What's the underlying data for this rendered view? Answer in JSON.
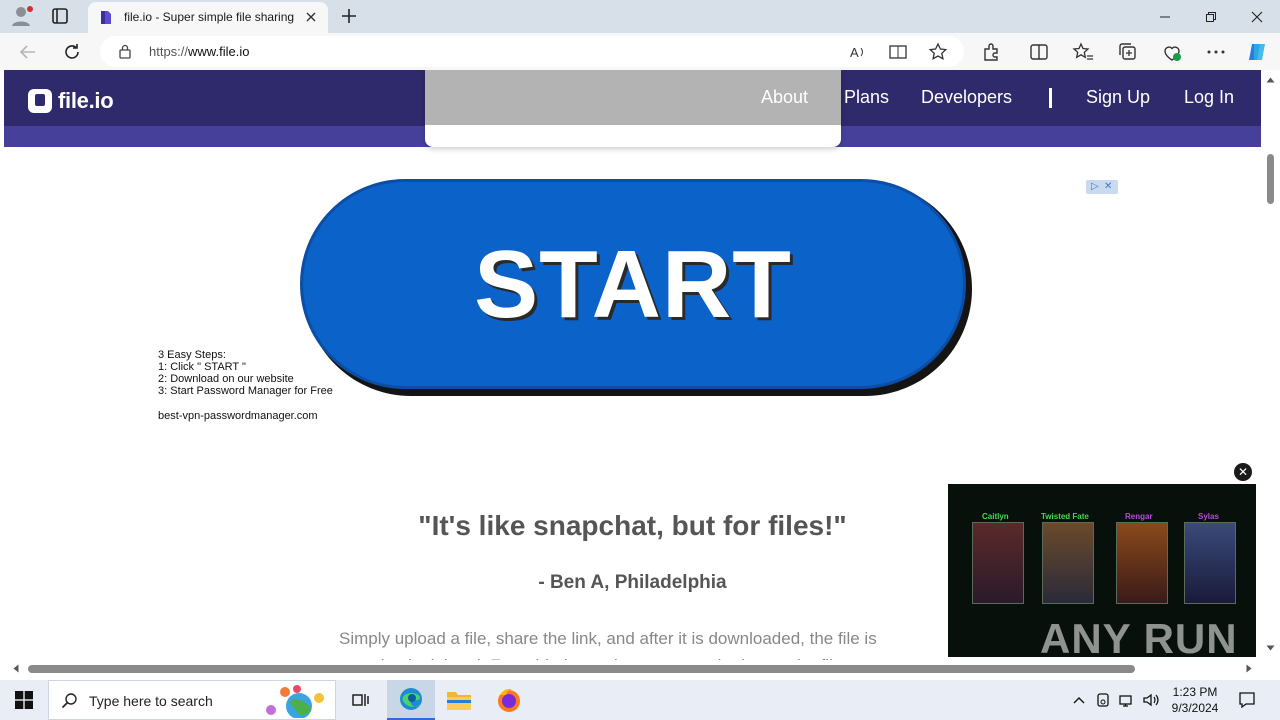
{
  "browser": {
    "tab_title": "file.io - Super simple file sharing",
    "url_prefix": "https://",
    "url_host": "www.file.io"
  },
  "site": {
    "logo_text": "file.io",
    "nav": {
      "about": "About",
      "plans": "Plans",
      "developers": "Developers",
      "sign_up": "Sign Up",
      "log_in": "Log In"
    }
  },
  "ad": {
    "button_label": "START",
    "steps": [
      "3 Easy Steps:",
      "1: Click \" START \"",
      "2: Download on our website",
      "3: Start Password Manager for Free"
    ],
    "domain": "best-vpn-passwordmanager.com"
  },
  "content": {
    "quote": "\"It's like snapchat, but for files!\"",
    "attribution": "- Ben A, Philadelphia",
    "description": "Simply upload a file, share the link, and after it is downloaded, the file is completely deleted. For added security, set an expiration on the file"
  },
  "video": {
    "champions": [
      {
        "name": "Caitlyn",
        "color": "#3ddc4a"
      },
      {
        "name": "Twisted Fate",
        "color": "#3ddc4a"
      },
      {
        "name": "Rengar",
        "color": "#b84bd9"
      },
      {
        "name": "Sylas",
        "color": "#b84bd9"
      }
    ],
    "watermark": "ANY RUN"
  },
  "taskbar": {
    "search_placeholder": "Type here to search",
    "time": "1:23 PM",
    "date": "9/3/2024"
  },
  "colors": {
    "header": "#2e2a6b",
    "header_subbar": "#46409b",
    "start_button": "#0b62c8"
  }
}
